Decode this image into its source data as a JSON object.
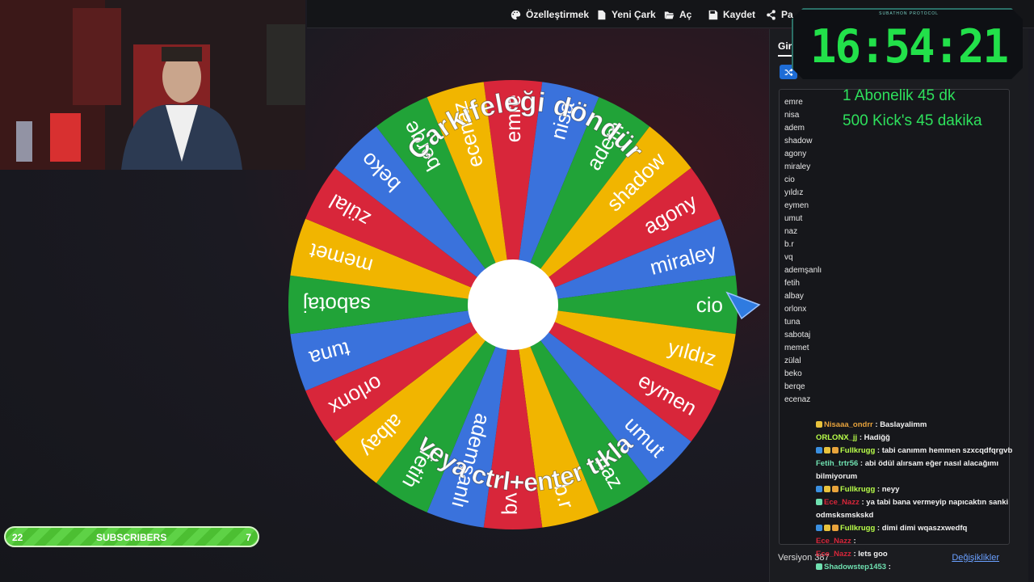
{
  "toolbar": {
    "items": [
      {
        "label": "Özelleştirmek",
        "icon": "palette-icon"
      },
      {
        "label": "Yeni Çark",
        "icon": "file-icon"
      },
      {
        "label": "Aç",
        "icon": "folder-open-icon"
      },
      {
        "label": "Kaydet",
        "icon": "save-icon"
      },
      {
        "label": "Pa",
        "icon": "share-icon"
      }
    ]
  },
  "wheel": {
    "top_text": "Çarkıfeleği döndür",
    "bottom_text": "veya ctrl+enter tıkla",
    "segment_colors": [
      "#d8263a",
      "#3a72dc",
      "#21a338",
      "#f1b500"
    ],
    "segments": [
      "emre",
      "nisa",
      "adem",
      "shadow",
      "agony",
      "miraley",
      "cio",
      "yıldız",
      "eymen",
      "umut",
      "naz",
      "b.r",
      "vq",
      "ademşanlı",
      "fetih",
      "albay",
      "orlonx",
      "tuna",
      "sabotaj",
      "memet",
      "zülal",
      "beko",
      "berqe",
      "ecenaz"
    ]
  },
  "panel": {
    "tab_label": "Gir",
    "names": [
      "emre",
      "nisa",
      "adem",
      "shadow",
      "agony",
      "miraley",
      "cio",
      "yıldız",
      "eymen",
      "umut",
      "naz",
      "b.r",
      "vq",
      "ademşanlı",
      "fetih",
      "albay",
      "orlonx",
      "tuna",
      "sabotaj",
      "memet",
      "zülal",
      "beko",
      "berqe",
      "ecenaz"
    ],
    "version": "Versiyon 387",
    "changes_link": "Değişiklikler"
  },
  "timer": {
    "label": "SUBATHON PROTOCOL",
    "time": "16:54:21",
    "lines": [
      "1 Abonelik 45 dk",
      "500 Kick's 45 dakika"
    ]
  },
  "chat": [
    {
      "user": "Nisaaa_ondrr",
      "color": "#e8a33c",
      "text": "Baslayalimm",
      "badges": [
        "#e8c23c"
      ]
    },
    {
      "user": "ORLONX_jj",
      "color": "#b9ff4a",
      "text": "Hadiğğ",
      "badges": []
    },
    {
      "user": "Fullkrugg",
      "color": "#b9ff4a",
      "text": "tabi canımm hemmen szxcqdfqrgvb",
      "badges": [
        "#3a8fe0",
        "#e8c23c",
        "#e8a33c"
      ]
    },
    {
      "user": "Fetih_trtr56",
      "color": "#6fe0b0",
      "text": "abi ödül alırsam eğer nasıl alacağımı bilmiyorum",
      "badges": []
    },
    {
      "user": "Fullkrugg",
      "color": "#b9ff4a",
      "text": "neyy",
      "badges": [
        "#3a8fe0",
        "#e8c23c",
        "#e8a33c"
      ]
    },
    {
      "user": "Ece_Nazz",
      "color": "#d8263a",
      "text": "ya tabi bana vermeyip napıcaktın sanki odmsksmskskd",
      "badges": [
        "#6fe0b0"
      ]
    },
    {
      "user": "Fullkrugg",
      "color": "#b9ff4a",
      "text": "dimi dimi wqaszxwedfq",
      "badges": [
        "#3a8fe0",
        "#e8c23c",
        "#e8a33c"
      ]
    },
    {
      "user": "Ece_Nazz",
      "color": "#d8263a",
      "text": "",
      "badges": []
    },
    {
      "user": "Ece_Nazz",
      "color": "#d8263a",
      "text": "lets goo",
      "badges": []
    },
    {
      "user": "Shadowstep1453",
      "color": "#6fe0b0",
      "text": "",
      "badges": [
        "#6fe0b0"
      ]
    }
  ],
  "subscribers": {
    "label": "SUBSCRIBERS",
    "current": "22",
    "goal": "7"
  }
}
